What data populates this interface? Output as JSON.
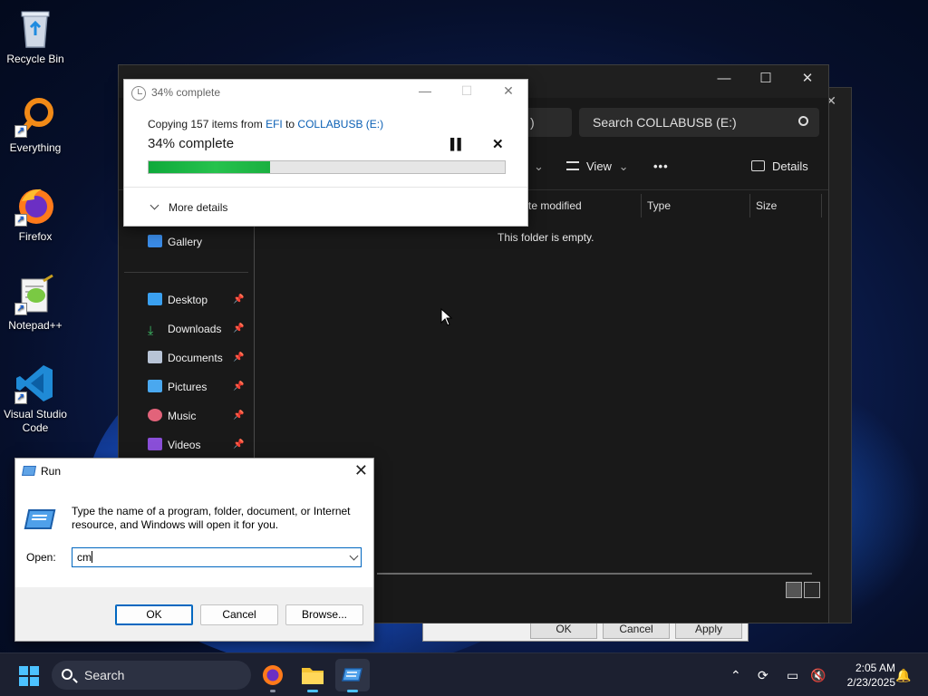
{
  "desktop": {
    "icons": [
      {
        "label": "Recycle Bin"
      },
      {
        "label": "Everything"
      },
      {
        "label": "Firefox"
      },
      {
        "label": "Notepad++"
      },
      {
        "label": "Visual Studio Code"
      }
    ]
  },
  "back_dialog": {
    "ok": "OK",
    "cancel": "Cancel",
    "apply": "Apply"
  },
  "explorer": {
    "search_placeholder": "Search COLLABUSB (E:)",
    "address_tail": ")",
    "toolbar": {
      "view": "View",
      "more": "•••",
      "details": "Details"
    },
    "columns": [
      "te modified",
      "Type",
      "Size"
    ],
    "empty_message": "This folder is empty.",
    "nav": {
      "gallery": "Gallery",
      "items": [
        "Desktop",
        "Downloads",
        "Documents",
        "Pictures",
        "Music",
        "Videos"
      ]
    }
  },
  "copy_dialog": {
    "title": "34% complete",
    "line_prefix": "Copying 157 items from ",
    "source": "EFI",
    "line_mid": " to ",
    "destination": "COLLABUSB (E:)",
    "percent_text": "34% complete",
    "progress": 0.34,
    "more_details": "More details"
  },
  "run_dialog": {
    "title": "Run",
    "description": "Type the name of a program, folder, document, or Internet resource, and Windows will open it for you.",
    "open_label": "Open:",
    "input_value": "cm",
    "ok": "OK",
    "cancel": "Cancel",
    "browse": "Browse..."
  },
  "taskbar": {
    "search": "Search",
    "time": "2:05 AM",
    "date": "2/23/2025"
  },
  "colors": {
    "progress_green": "#26c24d",
    "accent": "#0067c0",
    "taskbar_accent": "#4cc2ff"
  }
}
